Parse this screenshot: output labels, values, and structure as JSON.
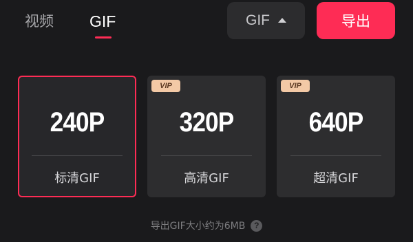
{
  "tabs": [
    {
      "label": "视频",
      "active": false
    },
    {
      "label": "GIF",
      "active": true
    }
  ],
  "format_dropdown": {
    "value": "GIF",
    "icon": "caret-up-icon"
  },
  "export_button": {
    "label": "导出"
  },
  "options": [
    {
      "resolution": "240P",
      "label": "标清GIF",
      "selected": true,
      "vip": false
    },
    {
      "resolution": "320P",
      "label": "高清GIF",
      "selected": false,
      "vip": true,
      "badge": "VIP"
    },
    {
      "resolution": "640P",
      "label": "超清GIF",
      "selected": false,
      "vip": true,
      "badge": "VIP"
    }
  ],
  "footer": {
    "text": "导出GIF大小约为6MB",
    "help_icon_glyph": "?"
  },
  "colors": {
    "accent": "#fe2c55",
    "background": "#1a1a1c",
    "card": "#2d2d2f",
    "vip_badge": "#f3c9a6"
  }
}
